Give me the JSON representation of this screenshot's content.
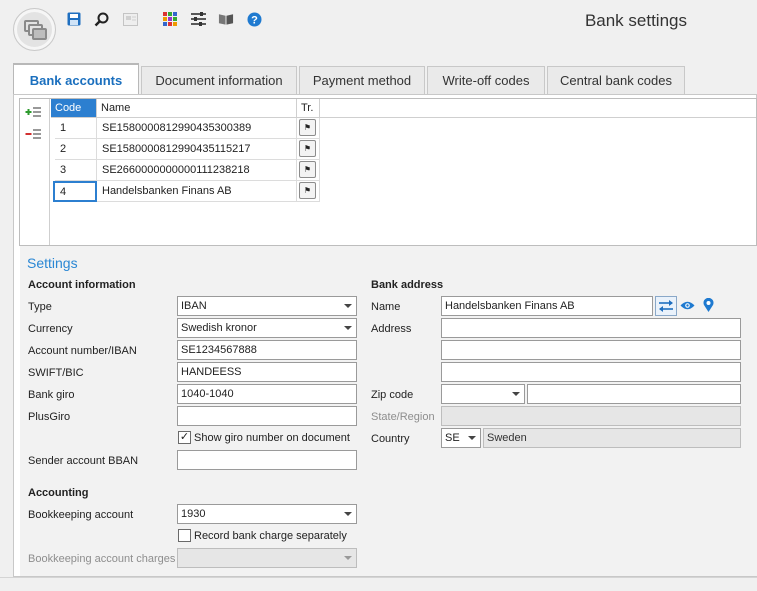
{
  "window": {
    "title": "Bank settings"
  },
  "toolbar": {
    "icons": [
      "app-logo-icon",
      "save-icon",
      "search-icon",
      "card-icon",
      "grid-colors-icon",
      "filter-settings-icon",
      "book-icon",
      "help-icon"
    ],
    "help_glyph": "?"
  },
  "tabs": [
    {
      "label": "Bank accounts",
      "active": true
    },
    {
      "label": "Document information",
      "active": false
    },
    {
      "label": "Payment method",
      "active": false
    },
    {
      "label": "Write-off codes",
      "active": false
    },
    {
      "label": "Central bank codes",
      "active": false
    }
  ],
  "grid": {
    "headers": {
      "code": "Code",
      "name": "Name",
      "tr": "Tr."
    },
    "rows": [
      {
        "code": "1",
        "name": "SE1580000812990435300389"
      },
      {
        "code": "2",
        "name": "SE1580000812990435115217"
      },
      {
        "code": "3",
        "name": "SE2660000000000111238218"
      },
      {
        "code": "4",
        "name": "Handelsbanken Finans AB"
      }
    ]
  },
  "settings": {
    "title": "Settings",
    "account_information": {
      "title": "Account information",
      "type_label": "Type",
      "type_value": "IBAN",
      "currency_label": "Currency",
      "currency_value": "Swedish kronor",
      "account_label": "Account number/IBAN",
      "account_value": "SE1234567888",
      "swift_label": "SWIFT/BIC",
      "swift_value": "HANDEESS",
      "bankgiro_label": "Bank giro",
      "bankgiro_value": "1040-1040",
      "plusgiro_label": "PlusGiro",
      "plusgiro_value": "",
      "show_giro_label": "Show giro number on document",
      "show_giro_checked": true,
      "sender_bban_label": "Sender account BBAN",
      "sender_bban_value": ""
    },
    "accounting": {
      "title": "Accounting",
      "bookkeeping_label": "Bookkeeping account",
      "bookkeeping_value": "1930",
      "record_charge_label": "Record bank charge separately",
      "record_charge_checked": false,
      "charges_label": "Bookkeeping account charges",
      "charges_value": ""
    },
    "bank_address": {
      "title": "Bank address",
      "name_label": "Name",
      "name_value": "Handelsbanken Finans  AB",
      "address_label": "Address",
      "address1": "",
      "address2": "",
      "address3": "",
      "zip_label": "Zip code",
      "zip_value": "",
      "city_value": "",
      "state_label": "State/Region",
      "state_value": "",
      "country_label": "Country",
      "country_code": "SE",
      "country_name": "Sweden"
    }
  },
  "colors": {
    "accent": "#2a87d4",
    "selected_header": "#2c7fd0",
    "add": "#2e9b2e",
    "remove": "#d23030"
  }
}
